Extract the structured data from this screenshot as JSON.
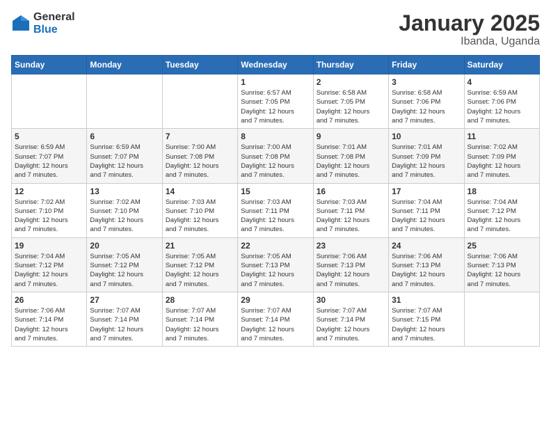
{
  "logo": {
    "general": "General",
    "blue": "Blue"
  },
  "title": {
    "month": "January 2025",
    "location": "Ibanda, Uganda"
  },
  "weekdays": [
    "Sunday",
    "Monday",
    "Tuesday",
    "Wednesday",
    "Thursday",
    "Friday",
    "Saturday"
  ],
  "weeks": [
    [
      {
        "day": "",
        "info": ""
      },
      {
        "day": "",
        "info": ""
      },
      {
        "day": "",
        "info": ""
      },
      {
        "day": "1",
        "info": "Sunrise: 6:57 AM\nSunset: 7:05 PM\nDaylight: 12 hours\nand 7 minutes."
      },
      {
        "day": "2",
        "info": "Sunrise: 6:58 AM\nSunset: 7:05 PM\nDaylight: 12 hours\nand 7 minutes."
      },
      {
        "day": "3",
        "info": "Sunrise: 6:58 AM\nSunset: 7:06 PM\nDaylight: 12 hours\nand 7 minutes."
      },
      {
        "day": "4",
        "info": "Sunrise: 6:59 AM\nSunset: 7:06 PM\nDaylight: 12 hours\nand 7 minutes."
      }
    ],
    [
      {
        "day": "5",
        "info": "Sunrise: 6:59 AM\nSunset: 7:07 PM\nDaylight: 12 hours\nand 7 minutes."
      },
      {
        "day": "6",
        "info": "Sunrise: 6:59 AM\nSunset: 7:07 PM\nDaylight: 12 hours\nand 7 minutes."
      },
      {
        "day": "7",
        "info": "Sunrise: 7:00 AM\nSunset: 7:08 PM\nDaylight: 12 hours\nand 7 minutes."
      },
      {
        "day": "8",
        "info": "Sunrise: 7:00 AM\nSunset: 7:08 PM\nDaylight: 12 hours\nand 7 minutes."
      },
      {
        "day": "9",
        "info": "Sunrise: 7:01 AM\nSunset: 7:08 PM\nDaylight: 12 hours\nand 7 minutes."
      },
      {
        "day": "10",
        "info": "Sunrise: 7:01 AM\nSunset: 7:09 PM\nDaylight: 12 hours\nand 7 minutes."
      },
      {
        "day": "11",
        "info": "Sunrise: 7:02 AM\nSunset: 7:09 PM\nDaylight: 12 hours\nand 7 minutes."
      }
    ],
    [
      {
        "day": "12",
        "info": "Sunrise: 7:02 AM\nSunset: 7:10 PM\nDaylight: 12 hours\nand 7 minutes."
      },
      {
        "day": "13",
        "info": "Sunrise: 7:02 AM\nSunset: 7:10 PM\nDaylight: 12 hours\nand 7 minutes."
      },
      {
        "day": "14",
        "info": "Sunrise: 7:03 AM\nSunset: 7:10 PM\nDaylight: 12 hours\nand 7 minutes."
      },
      {
        "day": "15",
        "info": "Sunrise: 7:03 AM\nSunset: 7:11 PM\nDaylight: 12 hours\nand 7 minutes."
      },
      {
        "day": "16",
        "info": "Sunrise: 7:03 AM\nSunset: 7:11 PM\nDaylight: 12 hours\nand 7 minutes."
      },
      {
        "day": "17",
        "info": "Sunrise: 7:04 AM\nSunset: 7:11 PM\nDaylight: 12 hours\nand 7 minutes."
      },
      {
        "day": "18",
        "info": "Sunrise: 7:04 AM\nSunset: 7:12 PM\nDaylight: 12 hours\nand 7 minutes."
      }
    ],
    [
      {
        "day": "19",
        "info": "Sunrise: 7:04 AM\nSunset: 7:12 PM\nDaylight: 12 hours\nand 7 minutes."
      },
      {
        "day": "20",
        "info": "Sunrise: 7:05 AM\nSunset: 7:12 PM\nDaylight: 12 hours\nand 7 minutes."
      },
      {
        "day": "21",
        "info": "Sunrise: 7:05 AM\nSunset: 7:12 PM\nDaylight: 12 hours\nand 7 minutes."
      },
      {
        "day": "22",
        "info": "Sunrise: 7:05 AM\nSunset: 7:13 PM\nDaylight: 12 hours\nand 7 minutes."
      },
      {
        "day": "23",
        "info": "Sunrise: 7:06 AM\nSunset: 7:13 PM\nDaylight: 12 hours\nand 7 minutes."
      },
      {
        "day": "24",
        "info": "Sunrise: 7:06 AM\nSunset: 7:13 PM\nDaylight: 12 hours\nand 7 minutes."
      },
      {
        "day": "25",
        "info": "Sunrise: 7:06 AM\nSunset: 7:13 PM\nDaylight: 12 hours\nand 7 minutes."
      }
    ],
    [
      {
        "day": "26",
        "info": "Sunrise: 7:06 AM\nSunset: 7:14 PM\nDaylight: 12 hours\nand 7 minutes."
      },
      {
        "day": "27",
        "info": "Sunrise: 7:07 AM\nSunset: 7:14 PM\nDaylight: 12 hours\nand 7 minutes."
      },
      {
        "day": "28",
        "info": "Sunrise: 7:07 AM\nSunset: 7:14 PM\nDaylight: 12 hours\nand 7 minutes."
      },
      {
        "day": "29",
        "info": "Sunrise: 7:07 AM\nSunset: 7:14 PM\nDaylight: 12 hours\nand 7 minutes."
      },
      {
        "day": "30",
        "info": "Sunrise: 7:07 AM\nSunset: 7:14 PM\nDaylight: 12 hours\nand 7 minutes."
      },
      {
        "day": "31",
        "info": "Sunrise: 7:07 AM\nSunset: 7:15 PM\nDaylight: 12 hours\nand 7 minutes."
      },
      {
        "day": "",
        "info": ""
      }
    ]
  ]
}
